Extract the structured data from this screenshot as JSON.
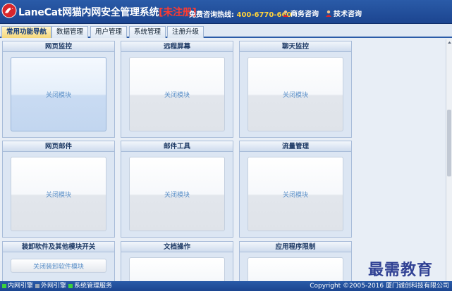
{
  "header": {
    "title": "LaneCat网猫内网安全管理系统",
    "unregistered": "[未注册]",
    "hotline_label": "免费咨询热线:",
    "hotline_number": "400-6770-660",
    "business_consult": "商务咨询",
    "tech_consult": "技术咨询"
  },
  "tabs": [
    "常用功能导航",
    "数据管理",
    "用户管理",
    "系统管理",
    "注册升级"
  ],
  "modules": [
    {
      "title": "网页监控",
      "label": "关闭模块"
    },
    {
      "title": "远程屏幕",
      "label": "关闭模块"
    },
    {
      "title": "聊天监控",
      "label": "关闭模块"
    },
    {
      "title": "网页邮件",
      "label": "关闭模块"
    },
    {
      "title": "邮件工具",
      "label": "关闭模块"
    },
    {
      "title": "流量管理",
      "label": "关闭模块"
    },
    {
      "title": "装卸软件及其他模块开关",
      "label": "关闭装卸软件模块"
    },
    {
      "title": "文档操作",
      "label": ""
    },
    {
      "title": "应用程序限制",
      "label": ""
    }
  ],
  "status": {
    "intranet_engine": "内网引擎",
    "extranet_engine": "外网引擎",
    "system_service": "系统管理服务",
    "copyright": "Copyright ©2005-2016 厦门诚创科技有限公司"
  },
  "watermark": "最需教育",
  "colors": {
    "header_bg": "#1c4590",
    "unregistered": "#ff3b30",
    "hotline": "#ffd23a",
    "status_green": "#3cd23c",
    "status_gray": "#9aa6b6"
  }
}
